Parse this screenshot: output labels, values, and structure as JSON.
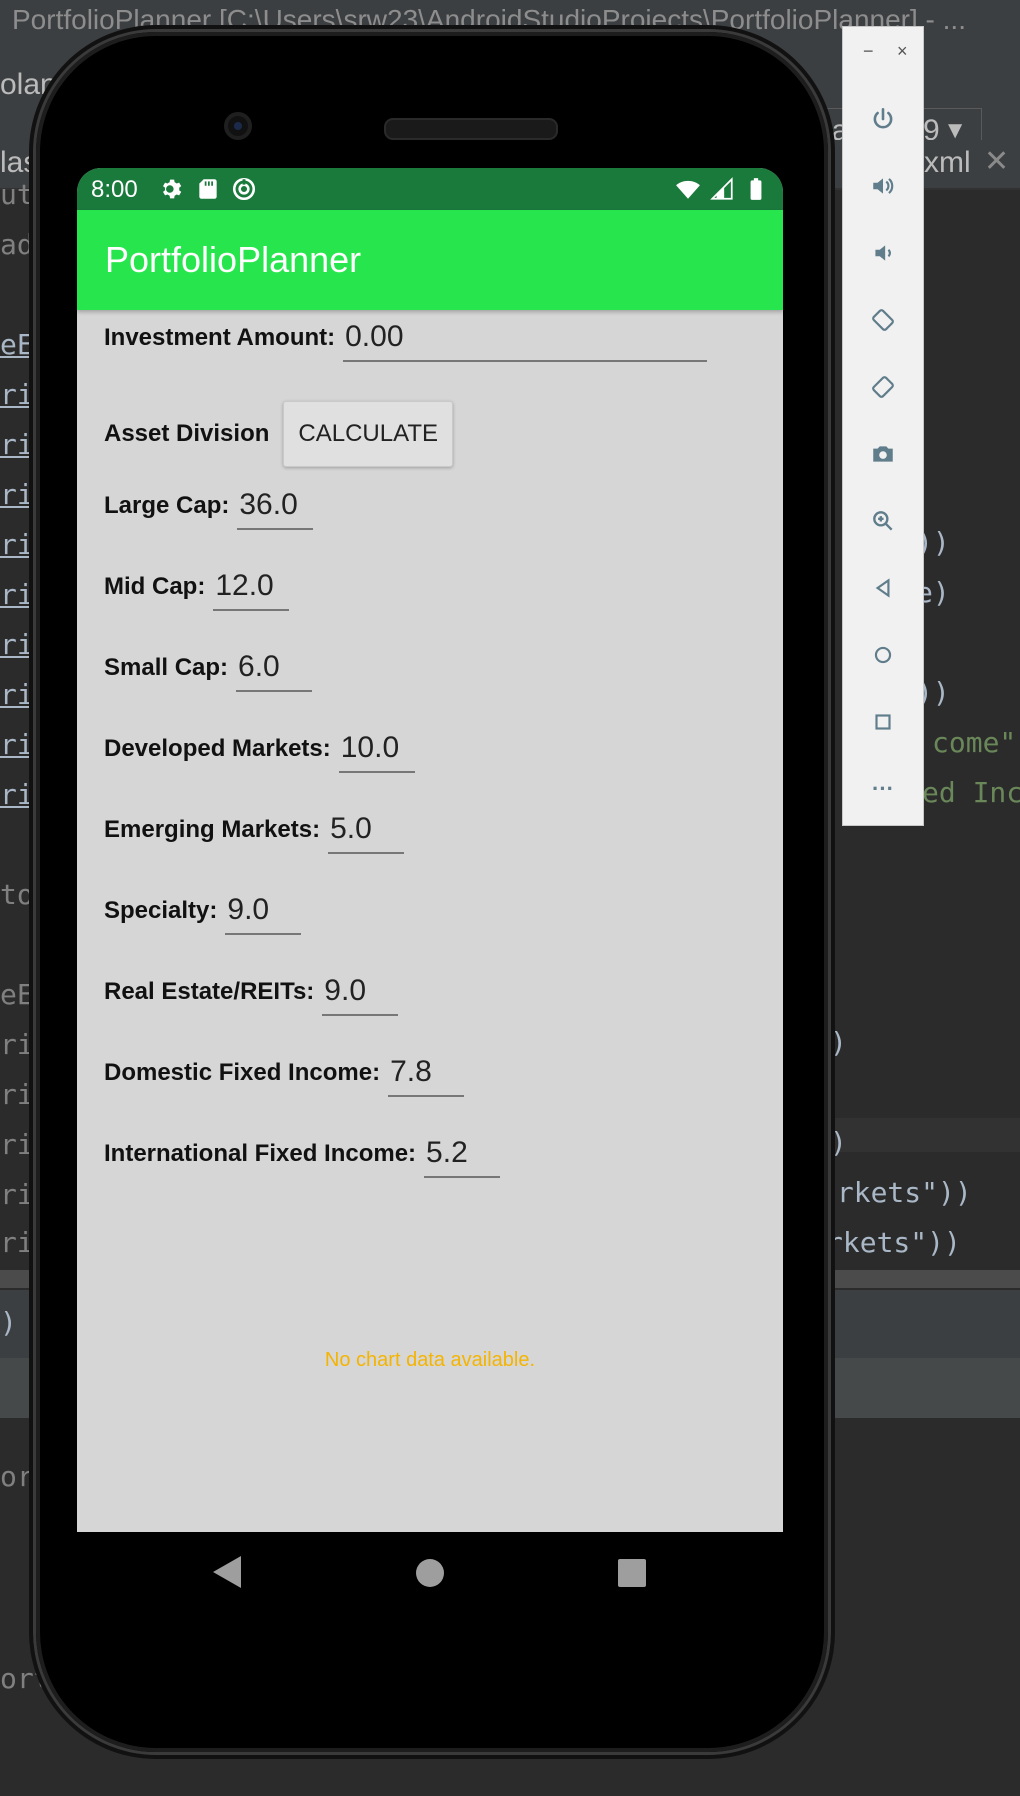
{
  "ide": {
    "window_title": "PortfolioPlanner [C:\\Users\\srw23\\AndroidStudioProjects\\PortfolioPlanner] - ...",
    "toolbar_left_text": "olan",
    "run_device": "3a",
    "run_device_suffix": "9",
    "tab_left": "las",
    "tab_right_file": "xml",
    "tab_right_partial": "rl",
    "code_left": [
      "ut",
      "ad",
      "eEr",
      "rie",
      "rie",
      "rie",
      "rie",
      "rie",
      "rie",
      "rie",
      "rie",
      "rie",
      "to",
      "eEr",
      "rie",
      "rie",
      "rie",
      "rie",
      "rie"
    ],
    "code_right": [
      "))",
      "e)",
      ")",
      "))",
      "come\")",
      "ed Inc",
      ")",
      ")",
      "arkets\"))",
      "rkets\"))"
    ],
    "panel_text_1": ")",
    "panel_text_2": "ort",
    "panel_text_3": "orti"
  },
  "status_bar": {
    "time": "8:00",
    "color": "#1a7a3c"
  },
  "app": {
    "title": "PortfolioPlanner",
    "bar_color": "#27e64d",
    "investment_label": "Investment Amount:",
    "investment_value": "0.00",
    "asset_division_label": "Asset Division",
    "calculate_button": "CALCULATE",
    "fields": [
      {
        "label": "Large Cap:",
        "value": "36.0"
      },
      {
        "label": "Mid Cap:",
        "value": "12.0"
      },
      {
        "label": "Small Cap:",
        "value": "6.0"
      },
      {
        "label": "Developed Markets:",
        "value": "10.0"
      },
      {
        "label": "Emerging Markets:",
        "value": "5.0"
      },
      {
        "label": "Specialty:",
        "value": "9.0"
      },
      {
        "label": "Real Estate/REITs:",
        "value": "9.0"
      },
      {
        "label": "Domestic Fixed Income:",
        "value": "7.8"
      },
      {
        "label": "International Fixed Income:",
        "value": "5.2"
      }
    ],
    "no_chart_text": "No chart data available."
  },
  "emulator_tools": {
    "window_controls": [
      "−",
      "×"
    ],
    "buttons": [
      "power-icon",
      "volume-up-icon",
      "volume-down-icon",
      "rotate-left-icon",
      "rotate-right-icon",
      "camera-icon",
      "zoom-icon",
      "back-icon",
      "home-icon",
      "overview-icon",
      "more-icon"
    ],
    "more_glyph": "···"
  }
}
